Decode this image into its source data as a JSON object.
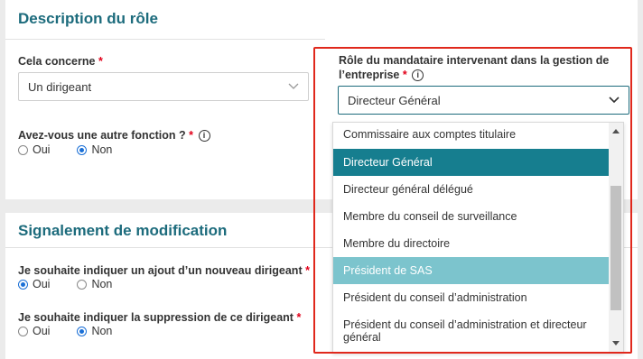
{
  "section1": {
    "title": "Description du rôle",
    "cela_concerne": {
      "label": "Cela concerne",
      "required": "*",
      "value": "Un dirigeant"
    },
    "autre_fonction": {
      "label": "Avez-vous une autre fonction ?",
      "required": "*",
      "info": "i",
      "options": [
        "Oui",
        "Non"
      ],
      "selected": "Non"
    },
    "role_mandataire": {
      "label_line1": "Rôle du mandataire intervenant dans la gestion de",
      "label_line2": "l’entreprise",
      "required": "*",
      "info": "i",
      "value": "Directeur Général"
    }
  },
  "dropdown": {
    "options": [
      "Commissaire aux comptes titulaire",
      "Directeur Général",
      "Directeur général délégué",
      "Membre du conseil de surveillance",
      "Membre du directoire",
      "Président de SAS",
      "Président du conseil d’administration",
      "Président du conseil d’administration et directeur général"
    ],
    "selected": "Directeur Général",
    "hovered": "Président de SAS"
  },
  "section2": {
    "title": "Signalement de modification",
    "ajout": {
      "label": "Je souhaite indiquer un ajout d’un nouveau dirigeant",
      "required": "*",
      "options": [
        "Oui",
        "Non"
      ],
      "selected": "Oui"
    },
    "suppression": {
      "label": "Je souhaite indiquer la suppression de ce dirigeant",
      "required": "*",
      "options": [
        "Oui",
        "Non"
      ],
      "selected": "Non"
    }
  },
  "colors": {
    "accent": "#1c6b7c",
    "selected_option": "#167e8f",
    "hovered_option": "#7cc4cd",
    "required": "#e2001a",
    "highlight_frame": "#e0281c",
    "radio": "#1a6fd6"
  }
}
